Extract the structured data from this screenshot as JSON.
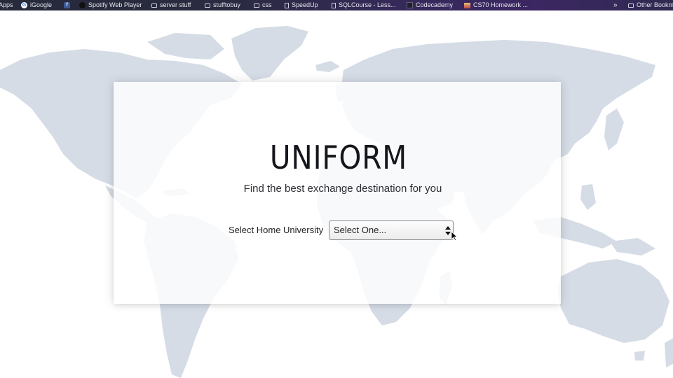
{
  "bookmarks": [
    {
      "label": "Apps",
      "icon": "apps-icon"
    },
    {
      "label": "iGoogle",
      "icon": "google-icon"
    },
    {
      "label": "",
      "icon": "facebook-icon"
    },
    {
      "label": "Spotify Web Player",
      "icon": "spotify-icon"
    },
    {
      "label": "server stuff",
      "icon": "folder-icon"
    },
    {
      "label": "stufftobuy",
      "icon": "folder-icon"
    },
    {
      "label": "css",
      "icon": "folder-icon"
    },
    {
      "label": "SpeedUp",
      "icon": "page-icon"
    },
    {
      "label": "SQLCourse - Less...",
      "icon": "page-icon"
    },
    {
      "label": "Codecademy",
      "icon": "codecademy-icon"
    },
    {
      "label": "CS70 Homework ...",
      "icon": "cs70-icon"
    },
    {
      "label": "»",
      "icon": "chevron-right-icon"
    },
    {
      "label": "Other Bookm",
      "icon": "folder-icon"
    }
  ],
  "hero": {
    "title": "UNIFORM",
    "subtitle": "Find the best exchange destination for you"
  },
  "form": {
    "label": "Select Home University",
    "select_value": "Select One..."
  },
  "colors": {
    "map": "#d5dce6",
    "card": "#ffffff",
    "bookmark_bar": "#2a2b41"
  }
}
